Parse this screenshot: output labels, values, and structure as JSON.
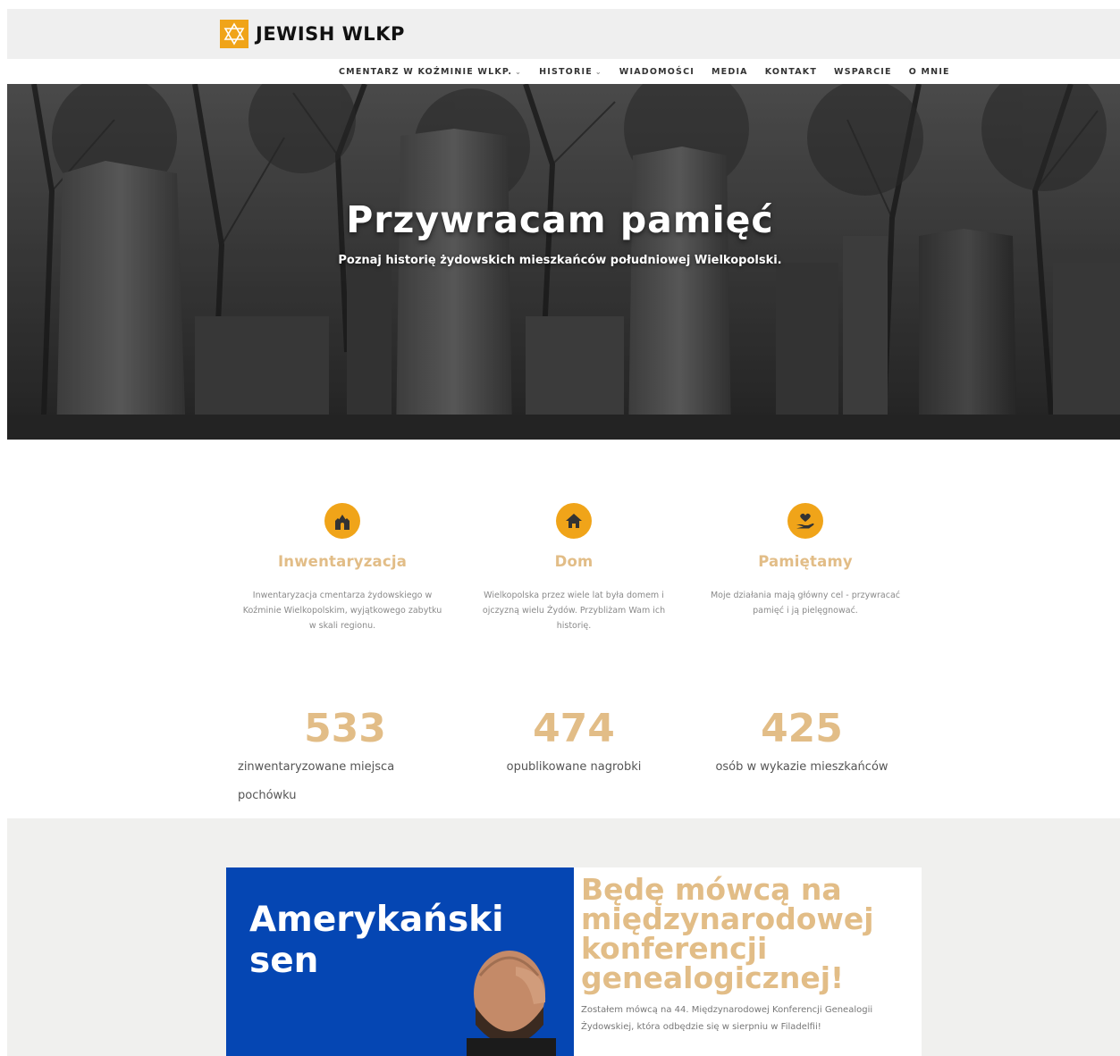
{
  "header": {
    "logo_text": "JEWISH WLKP",
    "brand_color": "#f0a419",
    "logo_icon": "star-of-david-icon"
  },
  "nav": {
    "items": [
      {
        "label": "CMENTARZ W KOŹMINIE WLKP.",
        "dropdown": true
      },
      {
        "label": "HISTORIE",
        "dropdown": true
      },
      {
        "label": "WIADOMOŚCI",
        "dropdown": false
      },
      {
        "label": "MEDIA",
        "dropdown": false
      },
      {
        "label": "KONTAKT",
        "dropdown": false
      },
      {
        "label": "WSPARCIE",
        "dropdown": false
      },
      {
        "label": "O MNIE",
        "dropdown": false
      }
    ],
    "chevron": "⌄"
  },
  "hero": {
    "title": "Przywracam pamięć",
    "subtitle": "Poznaj historię żydowskich mieszkańców południowej Wielkopolski."
  },
  "features": [
    {
      "icon": "synagogue-icon",
      "title": "Inwentaryzacja",
      "text": "Inwentaryzacja cmentarza żydowskiego w Koźminie Wielkopolskim, wyjątkowego zabytku w skali regionu."
    },
    {
      "icon": "home-icon",
      "title": "Dom",
      "text": "Wielkopolska przez wiele lat była domem i ojczyzną wielu Żydów. Przybliżam Wam ich historię."
    },
    {
      "icon": "hand-heart-icon",
      "title": "Pamiętamy",
      "text": "Moje działania mają główny cel - przywracać pamięć i ją pielęgnować."
    }
  ],
  "counters": [
    {
      "value": "533",
      "label": "zinwentaryzowane miejsca pochówku"
    },
    {
      "value": "474",
      "label": "opublikowane nagrobki"
    },
    {
      "value": "425",
      "label": "osób w wykazie mieszkańców"
    }
  ],
  "news": {
    "image_text": "Amerykański sen",
    "title": "Będę mówcą na międzynarodowej konferencji genealogicznej!",
    "excerpt": "Zostałem mówcą na 44. Międzynarodowej Konferencji Genealogii Żydowskiej, która odbędzie się w sierpniu w Filadelfii!"
  },
  "colors": {
    "accent": "#f0a419",
    "gold_text": "#e2bd87",
    "news_blue": "#0546b3",
    "section_bg": "#f0f0ee"
  }
}
